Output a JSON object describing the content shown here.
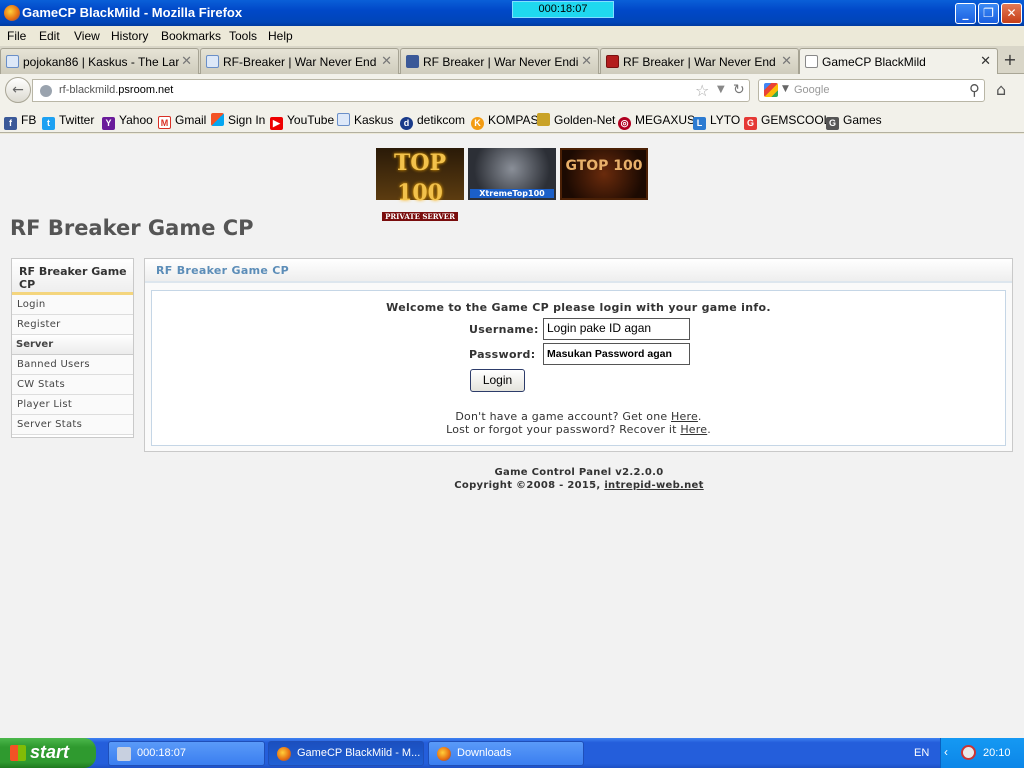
{
  "window": {
    "title": "GameCP BlackMild - Mozilla Firefox",
    "timer": "000:18:07"
  },
  "menu": [
    "File",
    "Edit",
    "View",
    "History",
    "Bookmarks",
    "Tools",
    "Help"
  ],
  "tabs": [
    {
      "label": "pojokan86 | Kaskus - The Larg...",
      "icon": "kaskus-icon",
      "active": false
    },
    {
      "label": "RF-Breaker | War Never End | ...",
      "icon": "kaskus-icon",
      "active": false
    },
    {
      "label": "RF Breaker | War Never Ending",
      "icon": "facebook-icon",
      "active": false
    },
    {
      "label": "RF Breaker | War Never End",
      "icon": "rf-icon",
      "active": false
    },
    {
      "label": "GameCP BlackMild",
      "icon": "blank-page-icon",
      "active": true
    }
  ],
  "nav": {
    "url_prefix": "rf-blackmild.",
    "url_domain": "psroom.net",
    "search_placeholder": "Google"
  },
  "bookmarks": [
    "FB",
    "Twitter",
    "Yahoo",
    "Gmail",
    "Sign In",
    "YouTube",
    "Kaskus",
    "detikcom",
    "KOMPAS",
    "Golden-Net",
    "MEGAXUS",
    "LYTO",
    "GEMSCOOL",
    "Games"
  ],
  "banners": {
    "top100": "TOP 100",
    "top100_sub": "PRIVATE SERVER",
    "xtreme": "XtremeTop100",
    "gtop": "GTOP 100"
  },
  "page": {
    "title": "RF Breaker Game CP",
    "sidebar": {
      "heading": "RF Breaker Game CP",
      "items": [
        "Login",
        "Register"
      ],
      "section": "Server",
      "server_items": [
        "Banned Users",
        "CW Stats",
        "Player List",
        "Server Stats"
      ]
    },
    "panel": {
      "heading": "RF Breaker Game CP",
      "welcome": "Welcome to the Game CP please login with your game info.",
      "username_label": "Username:",
      "username_value": "Login pake ID agan",
      "password_label": "Password:",
      "password_value": "Masukan Password agan",
      "login_button": "Login",
      "no_account": "Don't have a game account? Get one ",
      "no_account_link": "Here",
      "lost_password": "Lost or forgot your password? Recover it ",
      "lost_password_link": "Here"
    },
    "footer": {
      "line1": "Game Control Panel v2.2.0.0",
      "line2": "Copyright ©2008 - 2015, ",
      "link": "intrepid-web.net"
    }
  },
  "taskbar": {
    "start": "start",
    "tasks": [
      "000:18:07",
      "GameCP BlackMild - M...",
      "Downloads"
    ],
    "lang": "EN",
    "clock": "20:10"
  }
}
